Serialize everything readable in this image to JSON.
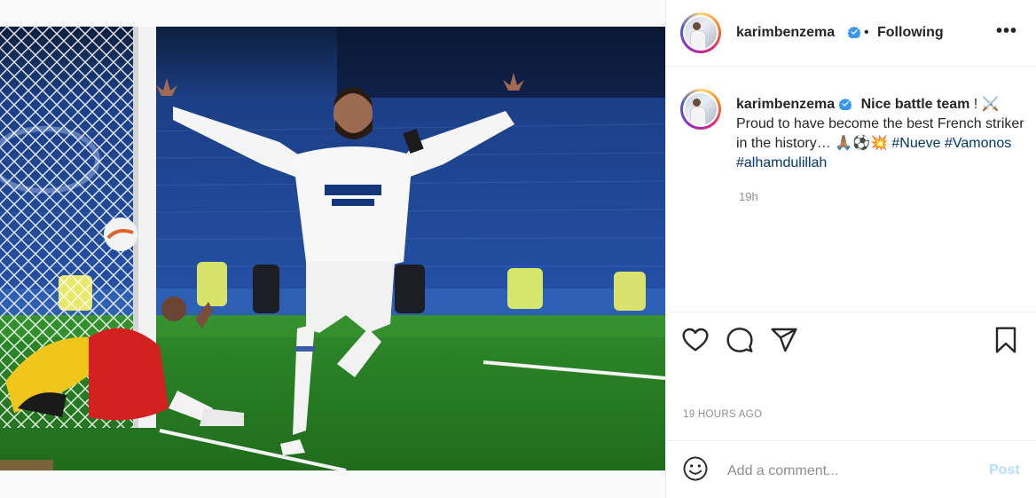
{
  "post": {
    "username": "karimbenzema",
    "follow_separator": "•",
    "follow_status": "Following",
    "more_options": "•••",
    "image_alt": "Player in white kit celebrating a goal with arms outstretched next to the goal net while a goalkeeper and defender lie on the pitch"
  },
  "caption": {
    "username": "karimbenzema",
    "bold_text": "Nice battle team",
    "text_after_bold": " ! ⚔️ Proud to have become the best French striker in the history… 🙏🏽⚽💥 ",
    "hashtags": [
      "#Nueve",
      "#Vamonos",
      "#alhamdulillah"
    ],
    "relative_time": "19h"
  },
  "actions": {
    "like_icon": "heart-icon",
    "comment_icon": "comment-icon",
    "share_icon": "share-icon",
    "save_icon": "bookmark-icon"
  },
  "timestamp": "19 HOURS AGO",
  "comment": {
    "emoji_icon": "emoji-icon",
    "placeholder": "Add a comment...",
    "post_label": "Post"
  },
  "colors": {
    "verified": "#3897f0",
    "hashtag": "#00376b",
    "post_button": "#b2dffc",
    "muted_text": "#8e8e8e"
  }
}
